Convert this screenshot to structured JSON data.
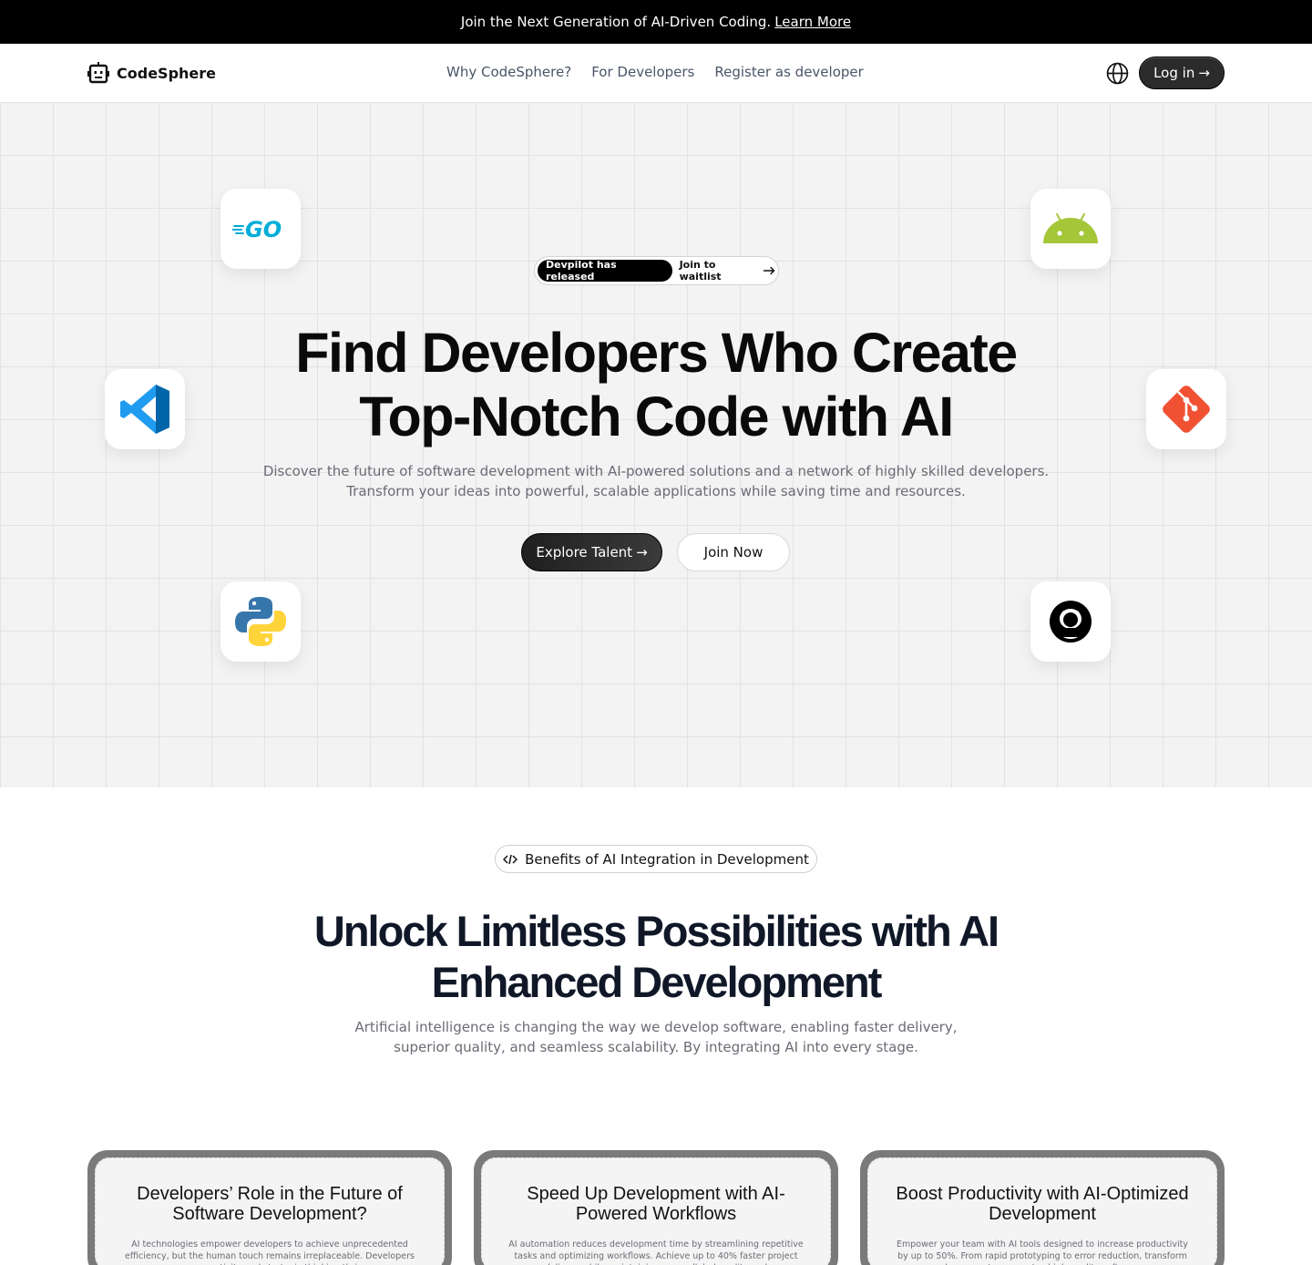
{
  "announcement": {
    "text": "Join the Next Generation of AI-Driven Coding.",
    "link": "Learn More"
  },
  "nav": {
    "brand": "CodeSphere",
    "links": [
      "Why CodeSphere?",
      "For Developers",
      "Register as developer"
    ],
    "login": "Log in"
  },
  "hero": {
    "pill_badge": "Devpilot has released",
    "pill_link": "Join to waitlist",
    "title_line1": "Find Developers Who Create",
    "title_line2": "Top-Notch Code with AI",
    "subtitle_line1": "Discover the future of software development with AI-powered solutions and a network of highly skilled developers.",
    "subtitle_line2": "Transform your ideas into powerful, scalable applications while saving time and resources.",
    "primary_button": "Explore Talent",
    "secondary_button": "Join Now",
    "tiles": [
      "go-icon",
      "android-icon",
      "vscode-icon",
      "git-icon",
      "python-icon",
      "github-icon"
    ]
  },
  "benefits": {
    "pill": "Benefits of AI Integration in Development",
    "title_line1": "Unlock Limitless Possibilities with AI",
    "title_line2": "Enhanced Development",
    "subtitle_line1": "Artificial intelligence is changing the way we develop software, enabling faster delivery,",
    "subtitle_line2": "superior quality, and seamless scalability. By integrating AI into every stage.",
    "cards": [
      {
        "title": "Developers’ Role in the Future of Software Development?",
        "text": "AI technologies empower developers to achieve unprecedented efficiency, but the human touch remains irreplaceable. Developers ensure creativity and strategic thinking thrive."
      },
      {
        "title": "Speed Up Development with AI-Powered Workflows",
        "text": "AI automation reduces development time by streamlining repetitive tasks and optimizing workflows. Achieve up to 40% faster project delivery while maintaining unparalleled quality and"
      },
      {
        "title": "Boost Productivity with AI-Optimized Development",
        "text": "Empower your team with AI tools designed to increase productivity by up to 50%. From rapid prototyping to error reduction, transform how your team creates high-quality software"
      }
    ]
  },
  "colors": {
    "dark": "#000000",
    "hero_bg": "#f3f3f4",
    "grid": "#e2e2e4",
    "git_orange": "#f05133",
    "android_green": "#a4c639",
    "go_cyan": "#00add8"
  }
}
